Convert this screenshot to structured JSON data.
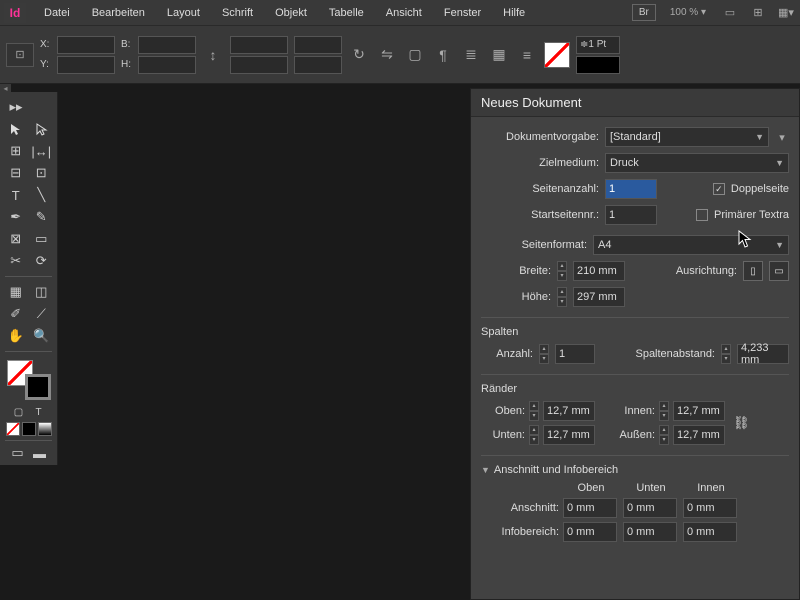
{
  "app": {
    "logo": "Id"
  },
  "menu": {
    "items": [
      "Datei",
      "Bearbeiten",
      "Layout",
      "Schrift",
      "Objekt",
      "Tabelle",
      "Ansicht",
      "Fenster",
      "Hilfe"
    ],
    "bridge": "Br",
    "zoom": "100 %"
  },
  "toolbar": {
    "x": "X:",
    "y": "Y:",
    "b": "B:",
    "h": "H:",
    "stroke_weight": "1 Pt"
  },
  "dialog": {
    "title": "Neues Dokument",
    "preset_label": "Dokumentvorgabe:",
    "preset_value": "[Standard]",
    "intent_label": "Zielmedium:",
    "intent_value": "Druck",
    "pages_label": "Seitenanzahl:",
    "pages_value": "1",
    "facing_label": "Doppelseite",
    "startpage_label": "Startseitennr.:",
    "startpage_value": "1",
    "primary_label": "Primärer Textra",
    "format_label": "Seitenformat:",
    "format_value": "A4",
    "width_label": "Breite:",
    "width_value": "210 mm",
    "height_label": "Höhe:",
    "height_value": "297 mm",
    "orient_label": "Ausrichtung:",
    "columns_head": "Spalten",
    "colcount_label": "Anzahl:",
    "colcount_value": "1",
    "gutter_label": "Spaltenabstand:",
    "gutter_value": "4,233 mm",
    "margins_head": "Ränder",
    "top_label": "Oben:",
    "bottom_label": "Unten:",
    "inside_label": "Innen:",
    "outside_label": "Außen:",
    "margin_value": "12,7 mm",
    "bleed_head": "Anschnitt und Infobereich",
    "col_top": "Oben",
    "col_bottom": "Unten",
    "col_inside": "Innen",
    "bleed_label": "Anschnitt:",
    "slug_label": "Infobereich:",
    "zero": "0 mm"
  }
}
